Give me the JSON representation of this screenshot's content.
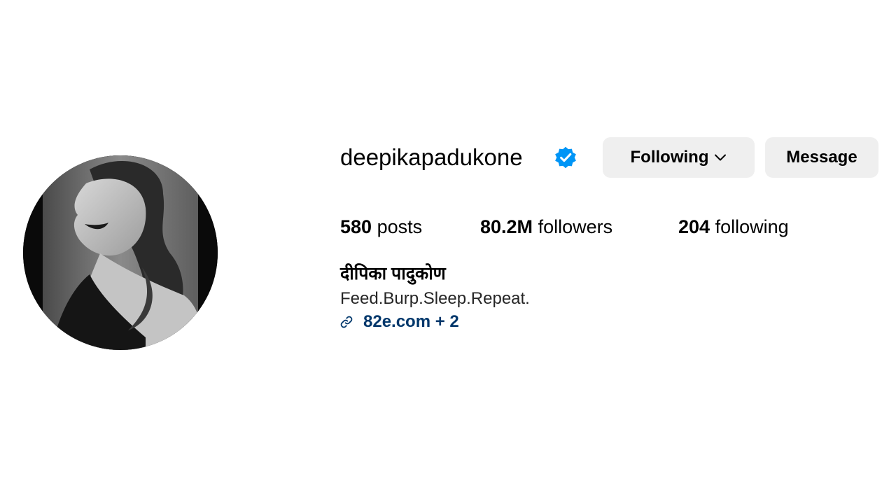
{
  "profile": {
    "username": "deepikapadukone",
    "verified": true,
    "full_name": "दीपिका पादुकोण",
    "bio": "Feed.Burp.Sleep.Repeat.",
    "link_text": "82e.com + 2",
    "avatar_icon": "profile-photo"
  },
  "actions": {
    "following_label": "Following",
    "message_label": "Message"
  },
  "stats": {
    "posts_count": "580",
    "posts_label": "posts",
    "followers_count": "80.2M",
    "followers_label": "followers",
    "following_count": "204",
    "following_label": "following"
  },
  "colors": {
    "verified_blue": "#0095f6",
    "button_bg": "#efefef",
    "link_color": "#00376b"
  }
}
